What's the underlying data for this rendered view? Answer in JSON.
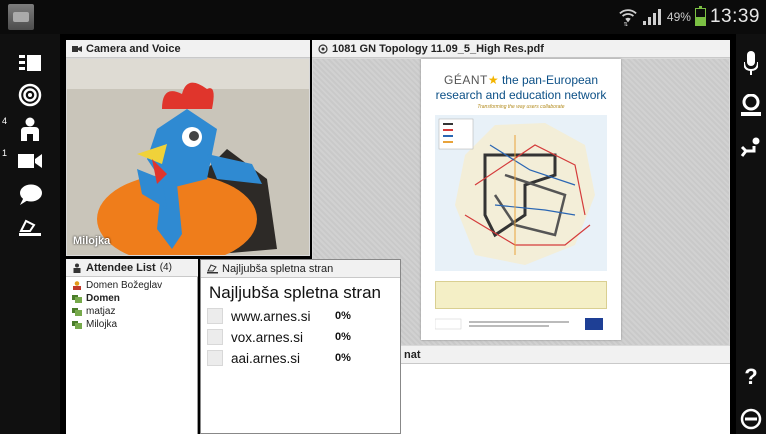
{
  "status_bar": {
    "battery_percent": "49%",
    "time": "13:39",
    "battery_level": 0.49
  },
  "left_toolbar": {
    "items": [
      {
        "icon": "layout-icon"
      },
      {
        "icon": "broadcast-icon"
      },
      {
        "icon": "attendees-icon",
        "badge": "4"
      },
      {
        "icon": "camera-icon",
        "badge": "1"
      },
      {
        "icon": "chat-bubble-icon"
      },
      {
        "icon": "raise-hand-icon"
      }
    ]
  },
  "right_toolbar": {
    "items": [
      {
        "icon": "microphone-icon"
      },
      {
        "icon": "webcam-icon"
      },
      {
        "icon": "hand-raise-icon"
      },
      {
        "icon": "help-icon",
        "label": "?"
      },
      {
        "icon": "minus-circle-icon"
      }
    ]
  },
  "camera_pod": {
    "title": "Camera and Voice",
    "speaker_name": "Milojka"
  },
  "document_pod": {
    "title": "1081 GN Topology 11.09_5_High Res.pdf",
    "page_brand": "GÉANT",
    "page_heading_1": "the pan-European",
    "page_heading_2": "research and education network",
    "page_tagline": "Transforming the way users collaborate"
  },
  "chat_pod": {
    "title_visible": "nat"
  },
  "attendee_pod": {
    "title": "Attendee List",
    "count": "(4)",
    "attendees": [
      {
        "name": "Domen Božeglav",
        "role": "host",
        "bold": false
      },
      {
        "name": "Domen",
        "role": "presenter",
        "bold": true
      },
      {
        "name": "matjaz",
        "role": "participant",
        "bold": false
      },
      {
        "name": "Milojka",
        "role": "participant",
        "bold": false
      }
    ]
  },
  "poll_pod": {
    "title": "Najljubša spletna stran",
    "question": "Najljubša spletna stran",
    "options": [
      {
        "label": "www.arnes.si",
        "percent": "0%"
      },
      {
        "label": "vox.arnes.si",
        "percent": "0%"
      },
      {
        "label": "aai.arnes.si",
        "percent": "0%"
      }
    ]
  },
  "colors": {
    "accent_blue": "#0b4f86",
    "battery_green": "#7bc043",
    "toolbar_bg": "#101010"
  }
}
